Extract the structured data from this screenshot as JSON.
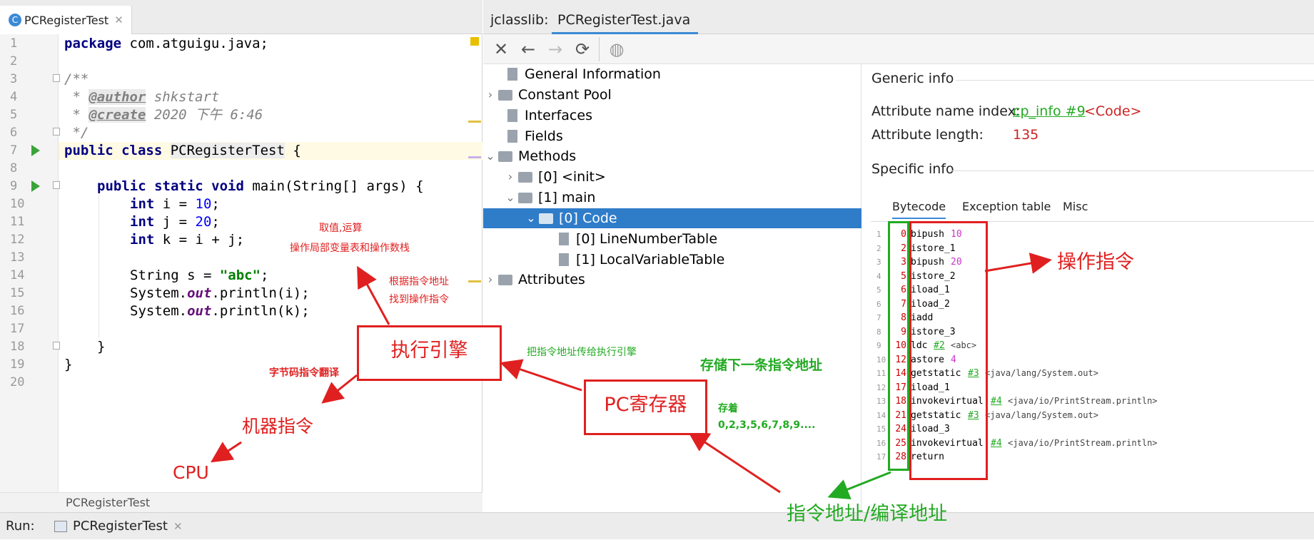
{
  "editor": {
    "tab_label": "PCRegisterTest",
    "tab_icon": "C",
    "line_numbers": [
      "1",
      "2",
      "3",
      "4",
      "5",
      "6",
      "7",
      "8",
      "9",
      "10",
      "11",
      "12",
      "13",
      "14",
      "15",
      "16",
      "17",
      "18",
      "19",
      "20"
    ],
    "footer": "PCRegisterTest",
    "code": {
      "l1_kw": "package",
      "l1_rest": " com.atguigu.java;",
      "l3": "/**",
      "l4_pre": " * ",
      "l4_tag": "@author",
      "l4_rest": " shkstart",
      "l5_pre": " * ",
      "l5_tag": "@create",
      "l5_rest": " 2020 下午 6:46",
      "l6": " */",
      "l7_kw": "public class",
      "l7_cls": "PCRegisterTest",
      "l7_rest": " {",
      "l9_kw": "public static void",
      "l9_rest": " main(String[] args) {",
      "l10_kw": "int",
      "l10_mid": " i = ",
      "l10_num": "10",
      "l10_end": ";",
      "l11_kw": "int",
      "l11_mid": " j = ",
      "l11_num": "20",
      "l11_end": ";",
      "l12_kw": "int",
      "l12_rest": " k = i + j;",
      "l14_pre": "String s = ",
      "l14_str": "\"abc\"",
      "l14_end": ";",
      "l15_pre": "System.",
      "l15_out": "out",
      "l15_rest": ".println(i);",
      "l16_pre": "System.",
      "l16_out": "out",
      "l16_rest": ".println(k);",
      "l18": "}",
      "l19": "}"
    }
  },
  "jclasslib": {
    "tab_prefix": "jclasslib:",
    "tab_label": "PCRegisterTest.java",
    "tree": {
      "general": "General Information",
      "constant_pool": "Constant Pool",
      "interfaces": "Interfaces",
      "fields": "Fields",
      "methods": "Methods",
      "init": "[0] <init>",
      "main": "[1] main",
      "code": "[0] Code",
      "line_number_table": "[0] LineNumberTable",
      "local_variable_table": "[1] LocalVariableTable",
      "attributes": "Attributes"
    },
    "generic_info": "Generic info",
    "attr_name_label": "Attribute name index:",
    "attr_name_link": "cp_info #9",
    "attr_name_value": "<Code>",
    "attr_length_label": "Attribute length:",
    "attr_length_value": "135",
    "specific_info": "Specific info",
    "subtabs": [
      "Bytecode",
      "Exception table",
      "Misc"
    ],
    "bytecode": [
      {
        "n": "1",
        "off": "0",
        "op": "bipush",
        "arg": "10",
        "ref": "",
        "cmt": ""
      },
      {
        "n": "2",
        "off": "2",
        "op": "istore_1",
        "arg": "",
        "ref": "",
        "cmt": ""
      },
      {
        "n": "3",
        "off": "3",
        "op": "bipush",
        "arg": "20",
        "ref": "",
        "cmt": ""
      },
      {
        "n": "4",
        "off": "5",
        "op": "istore_2",
        "arg": "",
        "ref": "",
        "cmt": ""
      },
      {
        "n": "5",
        "off": "6",
        "op": "iload_1",
        "arg": "",
        "ref": "",
        "cmt": ""
      },
      {
        "n": "6",
        "off": "7",
        "op": "iload_2",
        "arg": "",
        "ref": "",
        "cmt": ""
      },
      {
        "n": "7",
        "off": "8",
        "op": "iadd",
        "arg": "",
        "ref": "",
        "cmt": ""
      },
      {
        "n": "8",
        "off": "9",
        "op": "istore_3",
        "arg": "",
        "ref": "",
        "cmt": ""
      },
      {
        "n": "9",
        "off": "10",
        "op": "ldc",
        "arg": "",
        "ref": "#2",
        "cmt": "<abc>"
      },
      {
        "n": "10",
        "off": "12",
        "op": "astore",
        "arg": "4",
        "ref": "",
        "cmt": ""
      },
      {
        "n": "11",
        "off": "14",
        "op": "getstatic",
        "arg": "",
        "ref": "#3",
        "cmt": "<java/lang/System.out>"
      },
      {
        "n": "12",
        "off": "17",
        "op": "iload_1",
        "arg": "",
        "ref": "",
        "cmt": ""
      },
      {
        "n": "13",
        "off": "18",
        "op": "invokevirtual",
        "arg": "",
        "ref": "#4",
        "cmt": "<java/io/PrintStream.println>"
      },
      {
        "n": "14",
        "off": "21",
        "op": "getstatic",
        "arg": "",
        "ref": "#3",
        "cmt": "<java/lang/System.out>"
      },
      {
        "n": "15",
        "off": "24",
        "op": "iload_3",
        "arg": "",
        "ref": "",
        "cmt": ""
      },
      {
        "n": "16",
        "off": "25",
        "op": "invokevirtual",
        "arg": "",
        "ref": "#4",
        "cmt": "<java/io/PrintStream.println>"
      },
      {
        "n": "17",
        "off": "28",
        "op": "return",
        "arg": "",
        "ref": "",
        "cmt": ""
      }
    ]
  },
  "statusbar": {
    "run_label": "Run:",
    "run_tab": "PCRegisterTest"
  },
  "annotations": {
    "fetch": "取值,运算",
    "operate": "操作局部变量表和操作数栈",
    "find1": "根据指令地址",
    "find2": "找到操作指令",
    "engine": "执行引擎",
    "pass_addr": "把指令地址传给执行引擎",
    "store_next": "存储下一条指令地址",
    "translate": "字节码指令翻译",
    "pc_register": "PC寄存器",
    "stores": "存着",
    "stores_values": "0,2,3,5,6,7,8,9....",
    "machine": "机器指令",
    "cpu": "CPU",
    "op_instr": "操作指令",
    "addr": "指令地址/编译地址"
  },
  "colors": {
    "red": "#e02020",
    "green": "#22aa22",
    "selection": "#2f7cc9"
  }
}
